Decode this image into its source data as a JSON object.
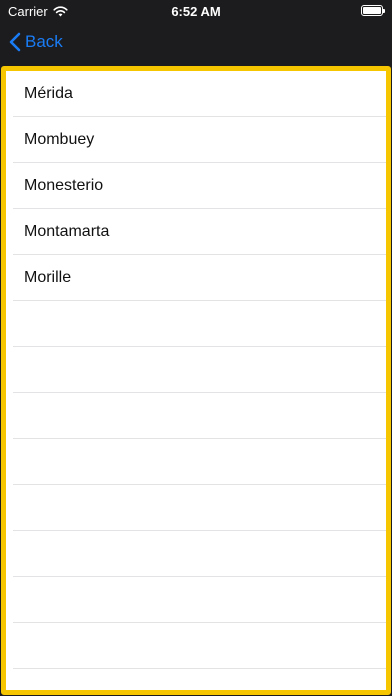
{
  "status_bar": {
    "carrier": "Carrier",
    "time": "6:52 AM",
    "wifi_icon": "wifi-icon",
    "battery_icon": "battery-icon"
  },
  "nav_bar": {
    "back_label": "Back",
    "back_icon": "chevron-left-icon",
    "accent_color": "#1a7cf5"
  },
  "content": {
    "border_color": "#f6c700",
    "items": [
      {
        "label": "Mérida"
      },
      {
        "label": "Mombuey"
      },
      {
        "label": "Monesterio"
      },
      {
        "label": "Montamarta"
      },
      {
        "label": "Morille"
      }
    ]
  }
}
